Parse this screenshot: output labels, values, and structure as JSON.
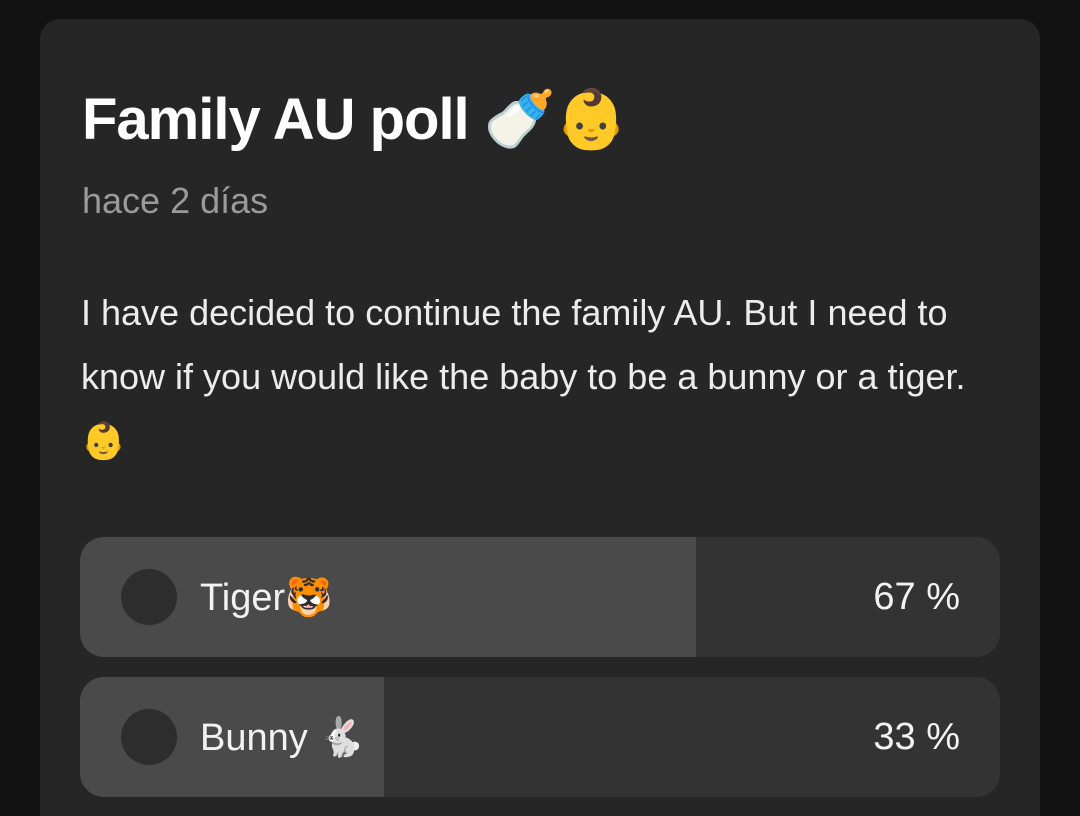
{
  "post": {
    "title": "Family AU poll",
    "title_emoji": "🍼👶",
    "timestamp": "hace 2 días",
    "body": "I have decided to continue the family AU. But I need to know if you would like the baby to be a bunny or a tiger.",
    "body_emoji": "👶"
  },
  "poll": {
    "options": [
      {
        "label": "Tiger",
        "emoji": "🐯",
        "percent_text": "67 %",
        "percent": 67
      },
      {
        "label": "Bunny",
        "emoji": "🐇",
        "percent_text": "33 %",
        "percent": 33
      }
    ]
  },
  "colors": {
    "background": "#121212",
    "card": "#262626",
    "option_track": "#333333",
    "option_fill": "#4a4a4a",
    "text_primary": "#ffffff",
    "text_secondary": "#9a9a9a"
  }
}
